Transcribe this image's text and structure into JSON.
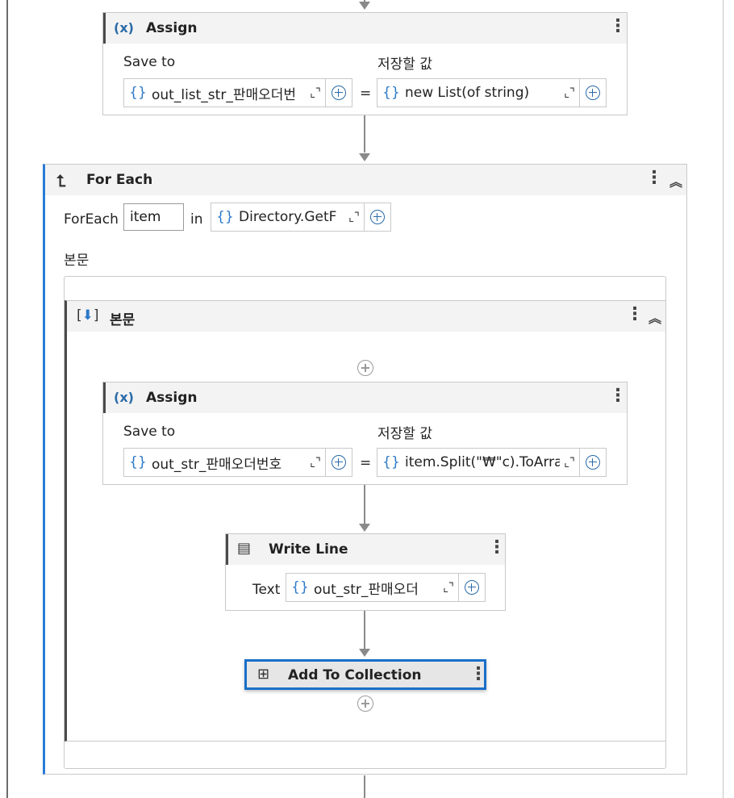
{
  "assign1": {
    "title": "Assign",
    "icon": "variable-icon",
    "save_to_label": "Save to",
    "value_label": "저장할 값",
    "left_field": "out_list_str_판매오더번",
    "equals": "=",
    "right_field": "new List(of string)"
  },
  "foreach": {
    "title": "For Each",
    "icon": "foreach-icon",
    "foreach_label": "ForEach",
    "item_value": "item",
    "in_label": "in",
    "collection_field": "Directory.GetF",
    "body_label": "본문"
  },
  "sequence": {
    "title": "본문",
    "icon": "sequence-icon"
  },
  "assign2": {
    "title": "Assign",
    "icon": "variable-icon",
    "save_to_label": "Save to",
    "value_label": "저장할 값",
    "left_field": "out_str_판매오더번호",
    "equals": "=",
    "right_field": "item.Split(\"₩\"c).ToArra"
  },
  "writeline": {
    "title": "Write Line",
    "icon": "writeline-icon",
    "text_label": "Text",
    "text_field": "out_str_판매오더"
  },
  "addtocollection": {
    "title": "Add To Collection",
    "icon": "add-to-collection-icon"
  },
  "icons": {
    "brace": "{}",
    "expand": "⌞⌝",
    "dots": "⋮",
    "collapse": "︽"
  },
  "colors": {
    "accent": "#2a78c8",
    "selected_border": "#1a6fc9",
    "foreach_border": "#2a7bd4"
  }
}
